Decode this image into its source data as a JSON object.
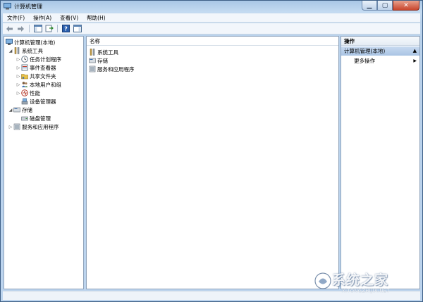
{
  "window": {
    "title": "计算机管理"
  },
  "menu": [
    {
      "label": "文件(F)"
    },
    {
      "label": "操作(A)"
    },
    {
      "label": "查看(V)"
    },
    {
      "label": "帮助(H)"
    }
  ],
  "toolbar": {
    "buttons": [
      "back-icon",
      "forward-icon",
      "show-hide-console-tree-icon",
      "export-list-icon",
      "help-icon",
      "action-pane-icon"
    ]
  },
  "tree": {
    "root": "计算机管理(本地)",
    "system_tools": "系统工具",
    "system_tools_children": [
      "任务计划程序",
      "事件查看器",
      "共享文件夹",
      "本地用户和组",
      "性能",
      "设备管理器"
    ],
    "storage": "存储",
    "storage_children": [
      "磁盘管理"
    ],
    "services": "服务和应用程序"
  },
  "center": {
    "column_header": "名称",
    "items": [
      "系统工具",
      "存储",
      "服务和应用程序"
    ]
  },
  "actions": {
    "header": "操作",
    "group": "计算机管理(本地)",
    "more": "更多操作"
  },
  "watermark": {
    "main": "系统之家",
    "sub": "XITONGZHIJIA.NET"
  },
  "colors": {
    "titlebar": "#b9d2ec",
    "close_button": "#c8462d",
    "actions_group": "#b8cfea"
  }
}
